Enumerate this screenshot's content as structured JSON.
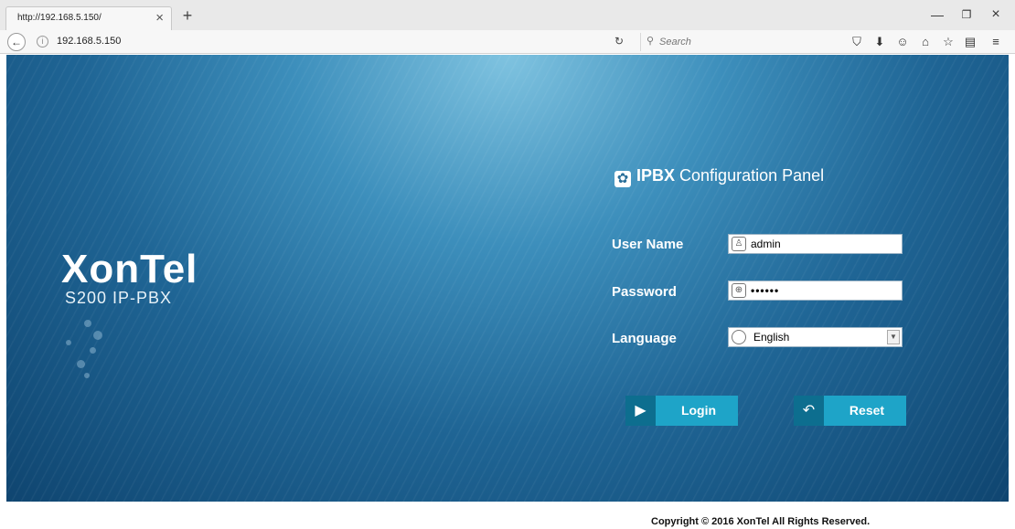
{
  "browser": {
    "tab_title": "http://192.168.5.150/",
    "address": "192.168.5.150",
    "search_placeholder": "Search"
  },
  "panel": {
    "title_bold": "IPBX",
    "title_rest": "Configuration Panel",
    "username_label": "User Name",
    "username_value": "admin",
    "password_label": "Password",
    "password_value": "••••••",
    "language_label": "Language",
    "language_value": "English",
    "login_label": "Login",
    "reset_label": "Reset"
  },
  "logo": {
    "name": "XonTel",
    "model": "S200 IP-PBX"
  },
  "footer": {
    "copyright": "Copyright © 2016 XonTel All Rights Reserved."
  },
  "colors": {
    "banner_dark": "#0f4570",
    "banner_light": "#7fc3e0",
    "button": "#1ea4c8",
    "button_icon": "#0d6e8f"
  }
}
